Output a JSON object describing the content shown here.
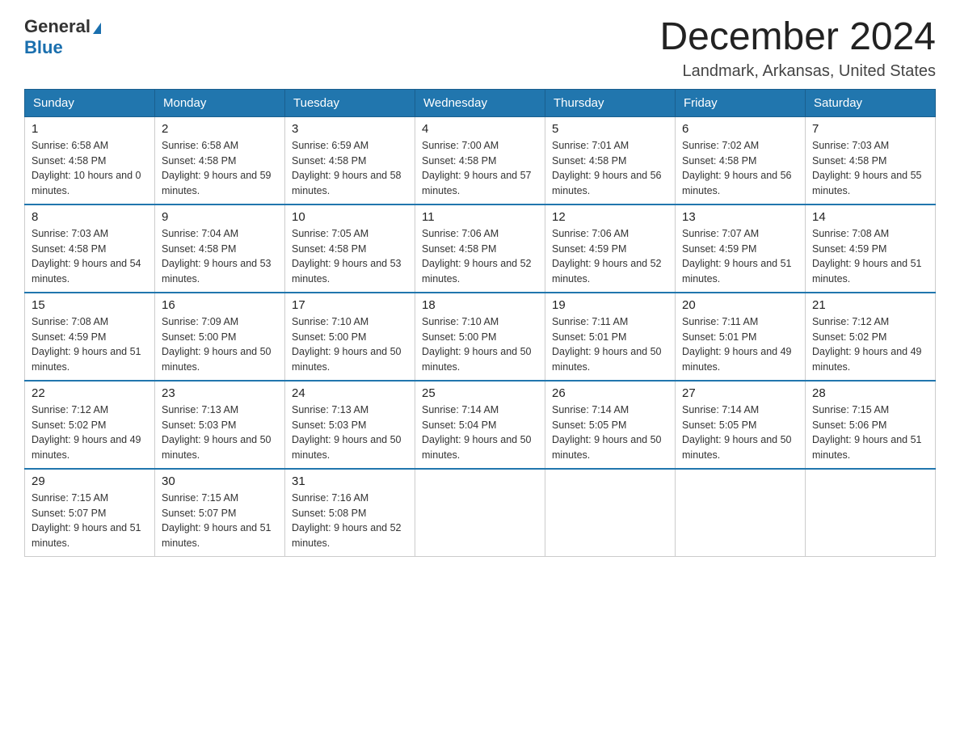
{
  "header": {
    "logo_line1": "General",
    "logo_line2": "Blue",
    "title": "December 2024",
    "subtitle": "Landmark, Arkansas, United States"
  },
  "weekdays": [
    "Sunday",
    "Monday",
    "Tuesday",
    "Wednesday",
    "Thursday",
    "Friday",
    "Saturday"
  ],
  "weeks": [
    [
      {
        "day": "1",
        "sunrise": "6:58 AM",
        "sunset": "4:58 PM",
        "daylight": "10 hours and 0 minutes."
      },
      {
        "day": "2",
        "sunrise": "6:58 AM",
        "sunset": "4:58 PM",
        "daylight": "9 hours and 59 minutes."
      },
      {
        "day": "3",
        "sunrise": "6:59 AM",
        "sunset": "4:58 PM",
        "daylight": "9 hours and 58 minutes."
      },
      {
        "day": "4",
        "sunrise": "7:00 AM",
        "sunset": "4:58 PM",
        "daylight": "9 hours and 57 minutes."
      },
      {
        "day": "5",
        "sunrise": "7:01 AM",
        "sunset": "4:58 PM",
        "daylight": "9 hours and 56 minutes."
      },
      {
        "day": "6",
        "sunrise": "7:02 AM",
        "sunset": "4:58 PM",
        "daylight": "9 hours and 56 minutes."
      },
      {
        "day": "7",
        "sunrise": "7:03 AM",
        "sunset": "4:58 PM",
        "daylight": "9 hours and 55 minutes."
      }
    ],
    [
      {
        "day": "8",
        "sunrise": "7:03 AM",
        "sunset": "4:58 PM",
        "daylight": "9 hours and 54 minutes."
      },
      {
        "day": "9",
        "sunrise": "7:04 AM",
        "sunset": "4:58 PM",
        "daylight": "9 hours and 53 minutes."
      },
      {
        "day": "10",
        "sunrise": "7:05 AM",
        "sunset": "4:58 PM",
        "daylight": "9 hours and 53 minutes."
      },
      {
        "day": "11",
        "sunrise": "7:06 AM",
        "sunset": "4:58 PM",
        "daylight": "9 hours and 52 minutes."
      },
      {
        "day": "12",
        "sunrise": "7:06 AM",
        "sunset": "4:59 PM",
        "daylight": "9 hours and 52 minutes."
      },
      {
        "day": "13",
        "sunrise": "7:07 AM",
        "sunset": "4:59 PM",
        "daylight": "9 hours and 51 minutes."
      },
      {
        "day": "14",
        "sunrise": "7:08 AM",
        "sunset": "4:59 PM",
        "daylight": "9 hours and 51 minutes."
      }
    ],
    [
      {
        "day": "15",
        "sunrise": "7:08 AM",
        "sunset": "4:59 PM",
        "daylight": "9 hours and 51 minutes."
      },
      {
        "day": "16",
        "sunrise": "7:09 AM",
        "sunset": "5:00 PM",
        "daylight": "9 hours and 50 minutes."
      },
      {
        "day": "17",
        "sunrise": "7:10 AM",
        "sunset": "5:00 PM",
        "daylight": "9 hours and 50 minutes."
      },
      {
        "day": "18",
        "sunrise": "7:10 AM",
        "sunset": "5:00 PM",
        "daylight": "9 hours and 50 minutes."
      },
      {
        "day": "19",
        "sunrise": "7:11 AM",
        "sunset": "5:01 PM",
        "daylight": "9 hours and 50 minutes."
      },
      {
        "day": "20",
        "sunrise": "7:11 AM",
        "sunset": "5:01 PM",
        "daylight": "9 hours and 49 minutes."
      },
      {
        "day": "21",
        "sunrise": "7:12 AM",
        "sunset": "5:02 PM",
        "daylight": "9 hours and 49 minutes."
      }
    ],
    [
      {
        "day": "22",
        "sunrise": "7:12 AM",
        "sunset": "5:02 PM",
        "daylight": "9 hours and 49 minutes."
      },
      {
        "day": "23",
        "sunrise": "7:13 AM",
        "sunset": "5:03 PM",
        "daylight": "9 hours and 50 minutes."
      },
      {
        "day": "24",
        "sunrise": "7:13 AM",
        "sunset": "5:03 PM",
        "daylight": "9 hours and 50 minutes."
      },
      {
        "day": "25",
        "sunrise": "7:14 AM",
        "sunset": "5:04 PM",
        "daylight": "9 hours and 50 minutes."
      },
      {
        "day": "26",
        "sunrise": "7:14 AM",
        "sunset": "5:05 PM",
        "daylight": "9 hours and 50 minutes."
      },
      {
        "day": "27",
        "sunrise": "7:14 AM",
        "sunset": "5:05 PM",
        "daylight": "9 hours and 50 minutes."
      },
      {
        "day": "28",
        "sunrise": "7:15 AM",
        "sunset": "5:06 PM",
        "daylight": "9 hours and 51 minutes."
      }
    ],
    [
      {
        "day": "29",
        "sunrise": "7:15 AM",
        "sunset": "5:07 PM",
        "daylight": "9 hours and 51 minutes."
      },
      {
        "day": "30",
        "sunrise": "7:15 AM",
        "sunset": "5:07 PM",
        "daylight": "9 hours and 51 minutes."
      },
      {
        "day": "31",
        "sunrise": "7:16 AM",
        "sunset": "5:08 PM",
        "daylight": "9 hours and 52 minutes."
      },
      null,
      null,
      null,
      null
    ]
  ]
}
